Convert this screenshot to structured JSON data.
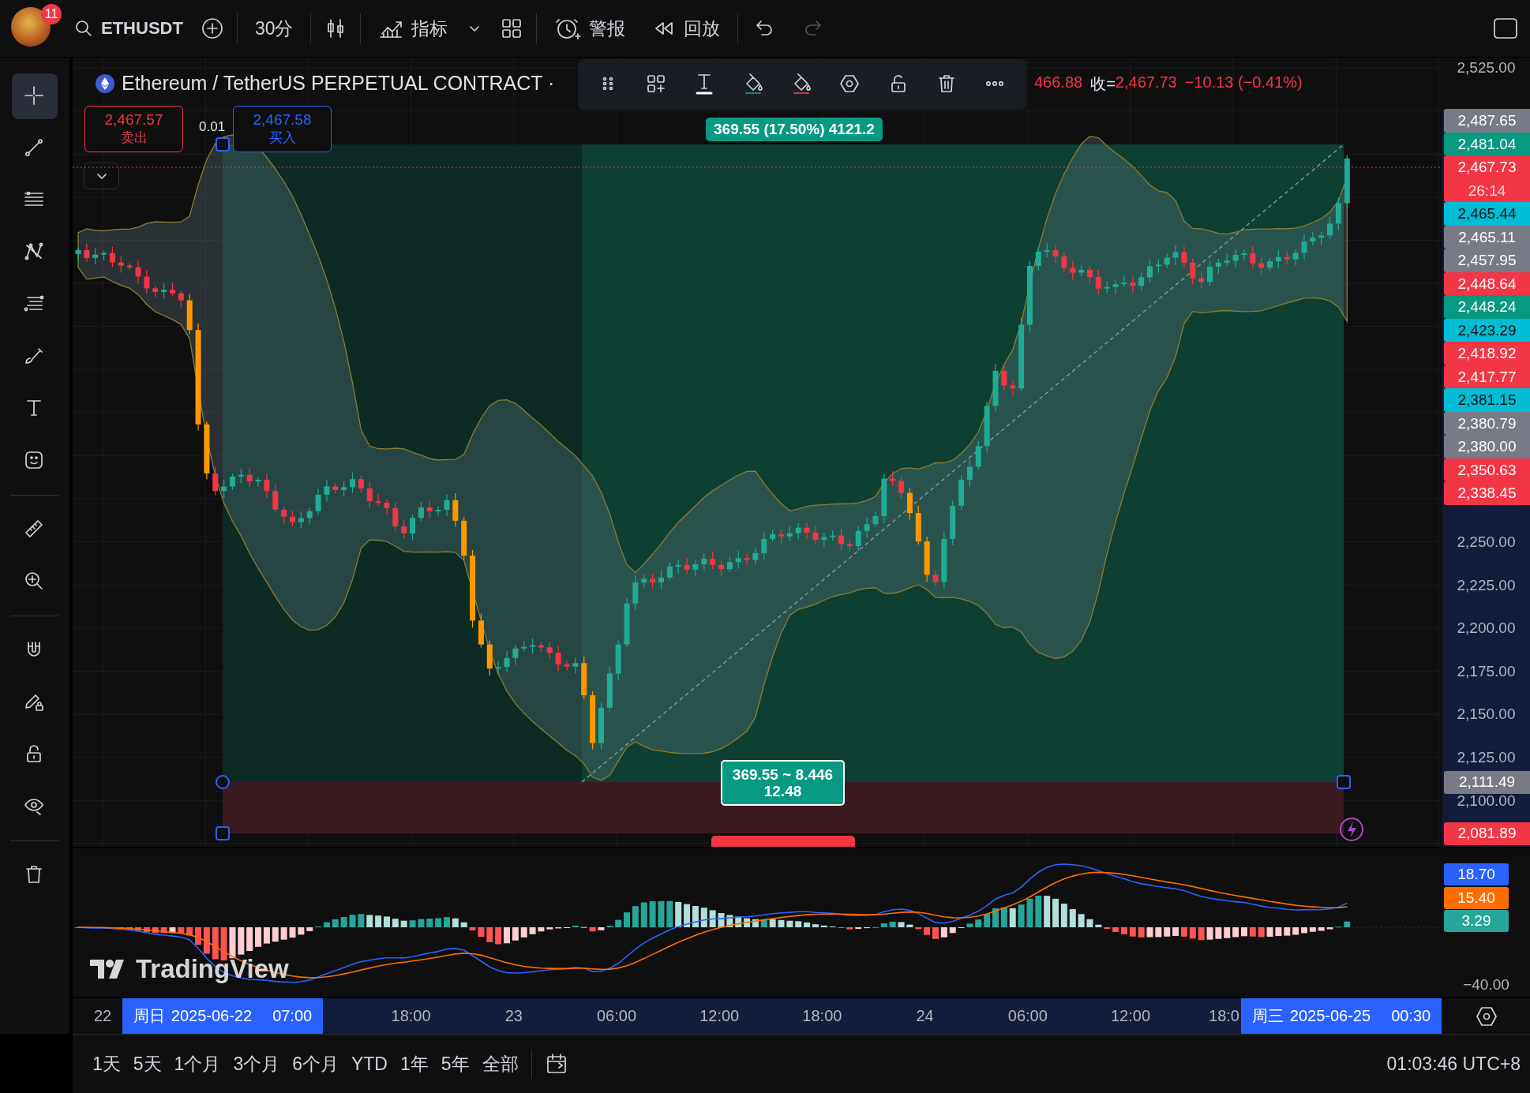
{
  "top_bar": {
    "notification_count": "11",
    "symbol": "ETHUSDT",
    "interval": "30分",
    "indicators": "指标",
    "alerts": "警报",
    "replay": "回放"
  },
  "left_toolbar": {
    "groups": [
      {
        "tools": [
          {
            "kind": "crosshair",
            "selected": true
          },
          {
            "kind": "trendline",
            "selected": false
          },
          {
            "kind": "hlines",
            "selected": false
          },
          {
            "kind": "pattern",
            "selected": false
          },
          {
            "kind": "fib",
            "selected": false
          },
          {
            "kind": "brush",
            "selected": false
          },
          {
            "kind": "text",
            "selected": false
          },
          {
            "kind": "sticker",
            "selected": false
          }
        ]
      },
      {
        "tools": [
          {
            "kind": "ruler",
            "selected": false
          },
          {
            "kind": "zoom",
            "selected": false
          }
        ]
      },
      {
        "tools": [
          {
            "kind": "magnet",
            "selected": false
          },
          {
            "kind": "pencil_lock",
            "selected": false
          },
          {
            "kind": "lock",
            "selected": false
          },
          {
            "kind": "eye",
            "selected": false
          }
        ]
      },
      {
        "tools": [
          {
            "kind": "trash",
            "selected": false
          }
        ]
      }
    ]
  },
  "chart": {
    "symbol_title": "Ethereum / TetherUS PERPETUAL CONTRACT ·",
    "last_open": "466.88",
    "close_label": "收=",
    "close_value": "2,467.73",
    "change": "−10.13 (−0.41%)",
    "sell": {
      "price": "2,467.57",
      "label": "卖出"
    },
    "spread": "0.01",
    "buy": {
      "price": "2,467.58",
      "label": "买入"
    },
    "drawing_toolbar": [
      {
        "kind": "drag"
      },
      {
        "kind": "template"
      },
      {
        "kind": "text"
      },
      {
        "kind": "fill_green"
      },
      {
        "kind": "fill_red"
      },
      {
        "kind": "hexagon"
      },
      {
        "kind": "unlock"
      },
      {
        "kind": "trash"
      },
      {
        "kind": "more"
      }
    ],
    "position": {
      "target_label": "369.55 (17.50%) 4121.2",
      "ratio": "369.55 ~ 8.446",
      "ratio_detail": "12.48"
    }
  },
  "price_axis": {
    "top_tick": "2,525.00",
    "labels": [
      {
        "text": "2,487.65",
        "color": "#787b86"
      },
      {
        "text": "2,481.04",
        "color": "#089981"
      },
      {
        "text": "2,467.73",
        "color": "#f23645",
        "countdown": "26:14"
      },
      {
        "text": "2,465.44",
        "color": "#00bcd4"
      },
      {
        "text": "2,465.11",
        "color": "#787b86"
      },
      {
        "text": "2,457.95",
        "color": "#787b86"
      },
      {
        "text": "2,448.64",
        "color": "#f23645"
      },
      {
        "text": "2,448.24",
        "color": "#089981"
      },
      {
        "text": "2,423.29",
        "color": "#00bcd4"
      },
      {
        "text": "2,418.92",
        "color": "#f23645"
      },
      {
        "text": "2,417.77",
        "color": "#f23645"
      },
      {
        "text": "2,381.15",
        "color": "#00bcd4"
      },
      {
        "text": "2,380.79",
        "color": "#787b86"
      },
      {
        "text": "2,380.00",
        "color": "#787b86"
      },
      {
        "text": "2,350.63",
        "color": "#f23645"
      },
      {
        "text": "2,338.45",
        "color": "#f23645"
      }
    ],
    "ticks": [
      "2,250.00",
      "2,225.00",
      "2,200.00",
      "2,175.00",
      "2,150.00",
      "2,125.00",
      "2,100.00"
    ],
    "lower_labels": [
      {
        "text": "2,111.49",
        "color": "#787b86"
      },
      {
        "text": "2,081.89",
        "color": "#f23645"
      }
    ]
  },
  "macd_axis": {
    "labels": [
      {
        "text": "18.70",
        "color": "#2962ff"
      },
      {
        "text": "15.40",
        "color": "#ff6d00"
      },
      {
        "text": "3.29",
        "color": "#26a69a"
      }
    ],
    "tick": "−40.00"
  },
  "brand": "TradingView",
  "time_axis": {
    "ticks": [
      "22",
      "18:00",
      "23",
      "06:00",
      "12:00",
      "18:00",
      "24",
      "06:00",
      "12:00",
      "18:0"
    ],
    "range_start": {
      "day": "周日",
      "date": "2025-06-22",
      "time": "07:00"
    },
    "range_end": {
      "day": "周三",
      "date": "2025-06-25",
      "time": "00:30"
    }
  },
  "bottom_bar": {
    "ranges": [
      "1天",
      "5天",
      "1个月",
      "3个月",
      "6个月",
      "YTD",
      "1年",
      "5年",
      "全部"
    ],
    "clock": "01:03:46 UTC+8"
  }
}
